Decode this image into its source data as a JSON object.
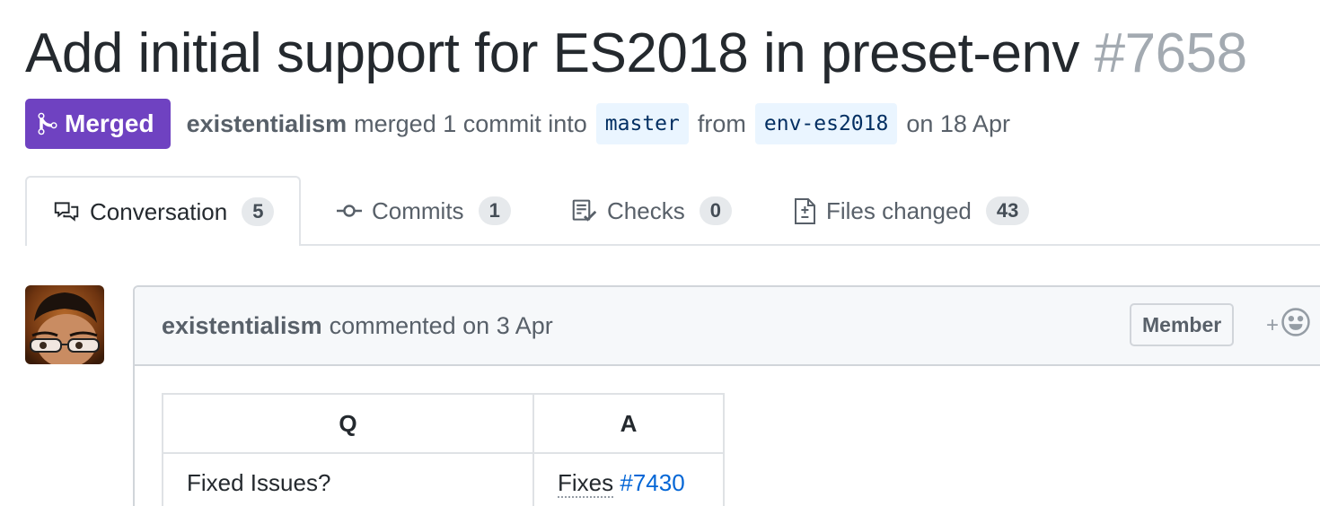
{
  "pr": {
    "title": "Add initial support for ES2018 in preset-env",
    "number": "#7658",
    "state": "Merged",
    "author": "existentialism",
    "merge_text": "merged 1 commit into",
    "base_branch": "master",
    "from_text": "from",
    "head_branch": "env-es2018",
    "date_text": "on 18 Apr"
  },
  "tabs": [
    {
      "label": "Conversation",
      "count": "5",
      "icon": "comment-discussion-icon"
    },
    {
      "label": "Commits",
      "count": "1",
      "icon": "git-commit-icon"
    },
    {
      "label": "Checks",
      "count": "0",
      "icon": "checklist-icon"
    },
    {
      "label": "Files changed",
      "count": "43",
      "icon": "file-diff-icon"
    }
  ],
  "comment": {
    "author": "existentialism",
    "meta": "commented on 3 Apr",
    "role_badge": "Member",
    "reaction_plus": "+",
    "table": {
      "headers": [
        "Q",
        "A"
      ],
      "rows": [
        {
          "q": "Fixed Issues?",
          "a_prefix": "Fixes",
          "a_link": "#7430"
        }
      ]
    }
  },
  "colors": {
    "merged": "#6f42c1",
    "link": "#0366d6",
    "branch_bg": "#eaf5ff"
  }
}
